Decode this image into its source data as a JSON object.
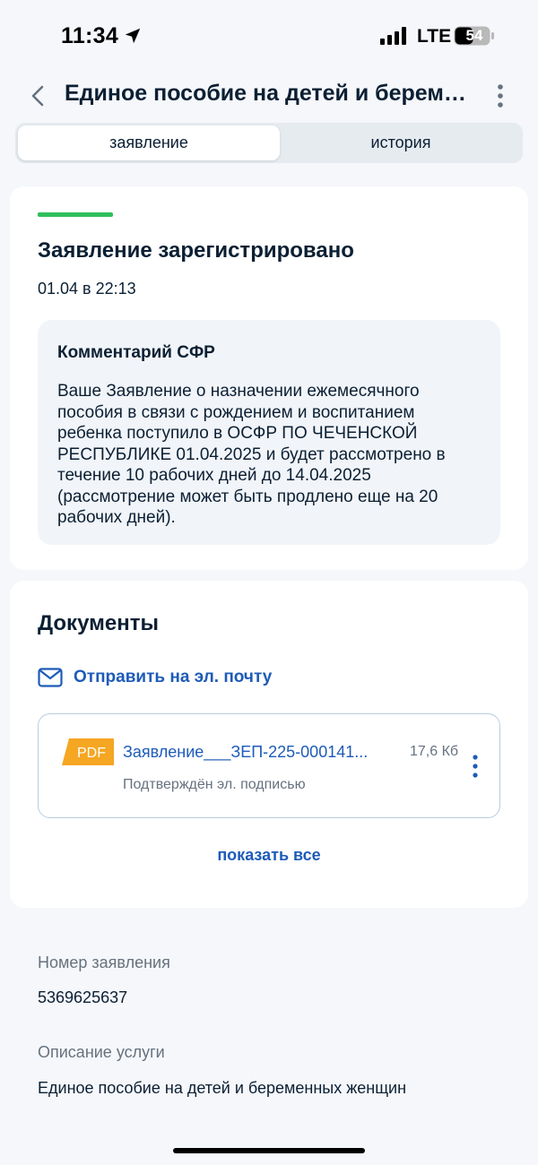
{
  "status_bar": {
    "time": "11:34",
    "network": "LTE",
    "battery": "54"
  },
  "header": {
    "title": "Единое пособие на детей и беременных женщин"
  },
  "tabs": [
    {
      "label": "заявление",
      "active": true
    },
    {
      "label": "история",
      "active": false
    }
  ],
  "status": {
    "title": "Заявление зарегистрировано",
    "date": "01.04 в 22:13",
    "accent_color": "#2ebf5b"
  },
  "comment": {
    "title": "Комментарий СФР",
    "text": "Ваше Заявление о назначении ежемесячного пособия в связи с рождением и воспитанием ребенка поступило в ОСФР ПО ЧЕЧЕНСКОЙ РЕСПУБЛИКЕ 01.04.2025 и будет рассмотрено в течение 10 рабочих дней до 14.04.2025 (рассмотрение может быть продлено еще на 20 рабочих дней)."
  },
  "documents": {
    "title": "Документы",
    "email_action": "Отправить на эл. почту",
    "file": {
      "type_badge": "PDF",
      "name": "Заявление___ЗЕП-225-000141...",
      "size": "17,6 Кб",
      "signature_status": "Подтверждён эл. подписью"
    },
    "show_all": "показать все"
  },
  "details": {
    "application_number_label": "Номер заявления",
    "application_number": "5369625637",
    "service_description_label": "Описание услуги",
    "service_description": "Единое пособие на детей и беременных женщин"
  },
  "colors": {
    "link": "#1e5bb8",
    "pdf_badge": "#f5a623"
  }
}
